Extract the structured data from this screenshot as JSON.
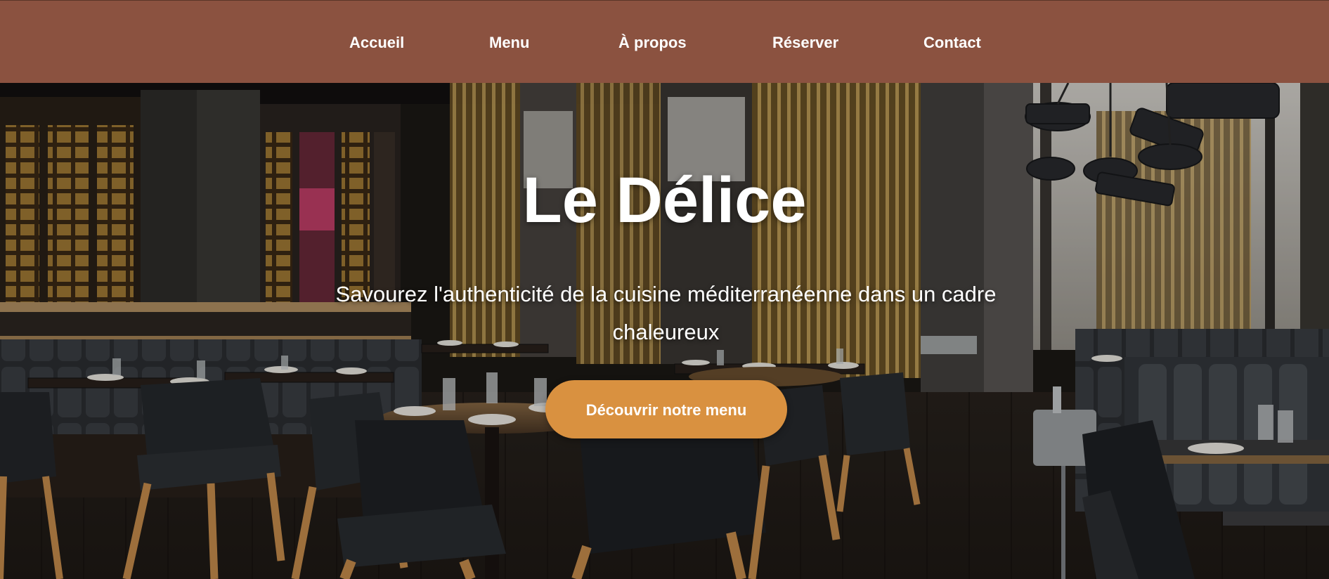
{
  "nav": {
    "items": [
      {
        "label": "Accueil"
      },
      {
        "label": "Menu"
      },
      {
        "label": "À propos"
      },
      {
        "label": "Réserver"
      },
      {
        "label": "Contact"
      }
    ]
  },
  "hero": {
    "title": "Le Délice",
    "subtitle": "Savourez l'authenticité de la cuisine méditerranéenne dans un cadre chaleureux",
    "cta_label": "Découvrir notre menu",
    "background_image": "restaurant-interior-photo"
  },
  "colors": {
    "navbar": "#8b5240",
    "cta": "#d99140",
    "text": "#ffffff"
  }
}
